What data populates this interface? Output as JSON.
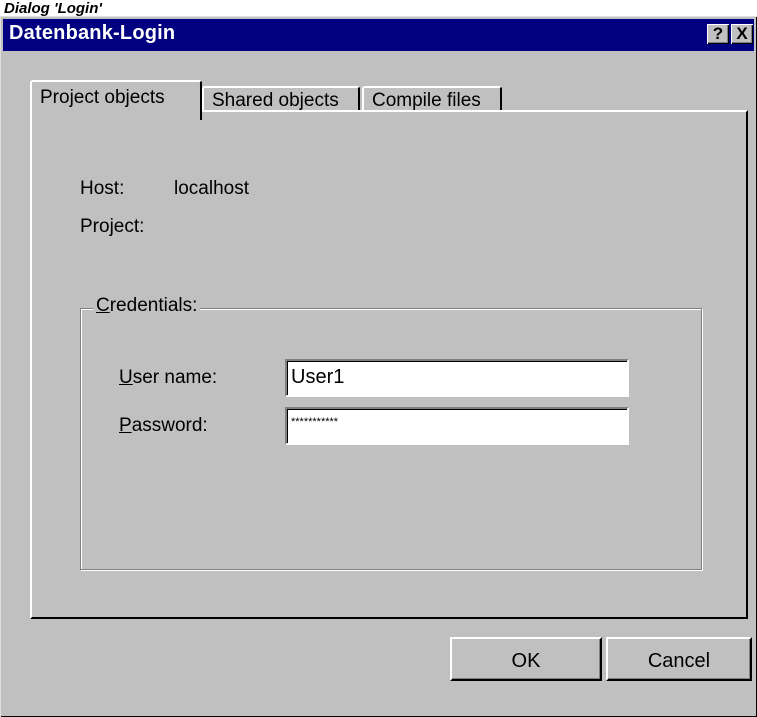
{
  "caption": "Dialog 'Login'",
  "window": {
    "title": "Datenbank-Login",
    "help_label": "?",
    "close_label": "X"
  },
  "tabs": [
    {
      "label": "Project objects",
      "active": true
    },
    {
      "label": "Shared objects",
      "active": false
    },
    {
      "label": "Compile files",
      "active": false
    }
  ],
  "info": {
    "host_label": "Host:",
    "host_value": "localhost",
    "project_label": "Project:",
    "project_value": ""
  },
  "credentials": {
    "legend_accel": "C",
    "legend_rest": "redentials:",
    "username_accel": "U",
    "username_rest": "ser name:",
    "username_value": "User1",
    "password_accel": "P",
    "password_rest": "assword:",
    "password_value": "***********"
  },
  "buttons": {
    "ok": "OK",
    "cancel": "Cancel"
  },
  "colors": {
    "titlebar": "#000080",
    "face": "#c0c0c0"
  }
}
